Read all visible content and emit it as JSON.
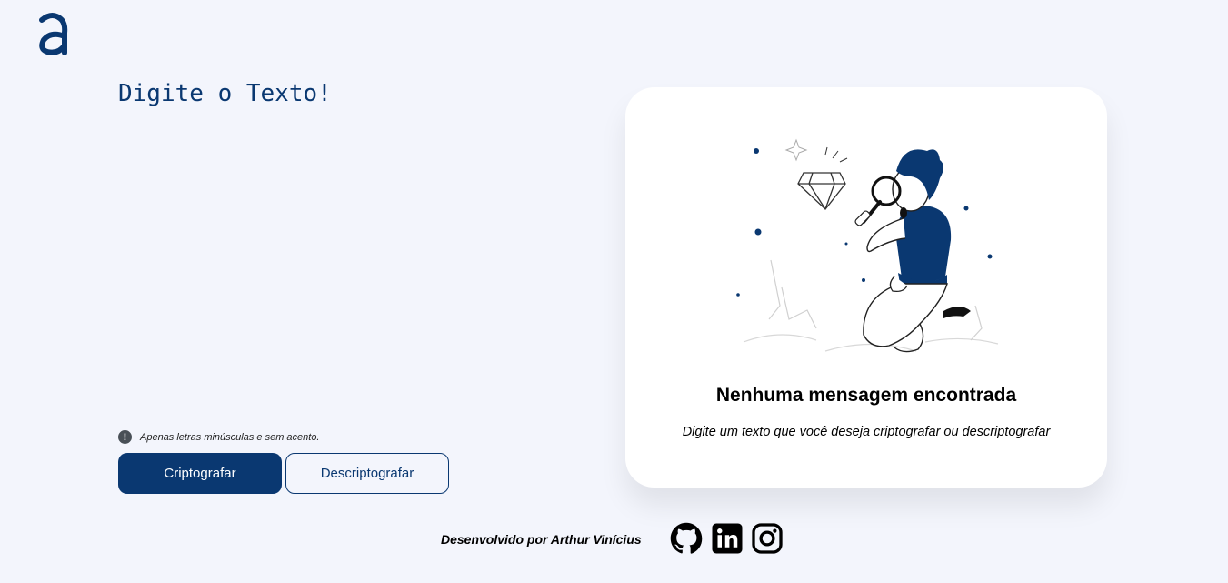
{
  "textarea": {
    "placeholder": "Digite o Texto!",
    "value": ""
  },
  "hint": {
    "text": "Apenas letras minúsculas e sem acento."
  },
  "buttons": {
    "encrypt": "Criptografar",
    "decrypt": "Descriptografar"
  },
  "output_card": {
    "title": "Nenhuma mensagem encontrada",
    "subtitle": "Digite um texto que você deseja criptografar ou descriptografar"
  },
  "footer": {
    "credit": "Desenvolvido por Arthur Vinícius"
  },
  "colors": {
    "brand": "#0a3871",
    "background": "#f3f5fc",
    "card": "#ffffff"
  },
  "icons": [
    "alura-logo",
    "info-icon",
    "github-icon",
    "linkedin-icon",
    "instagram-icon"
  ]
}
